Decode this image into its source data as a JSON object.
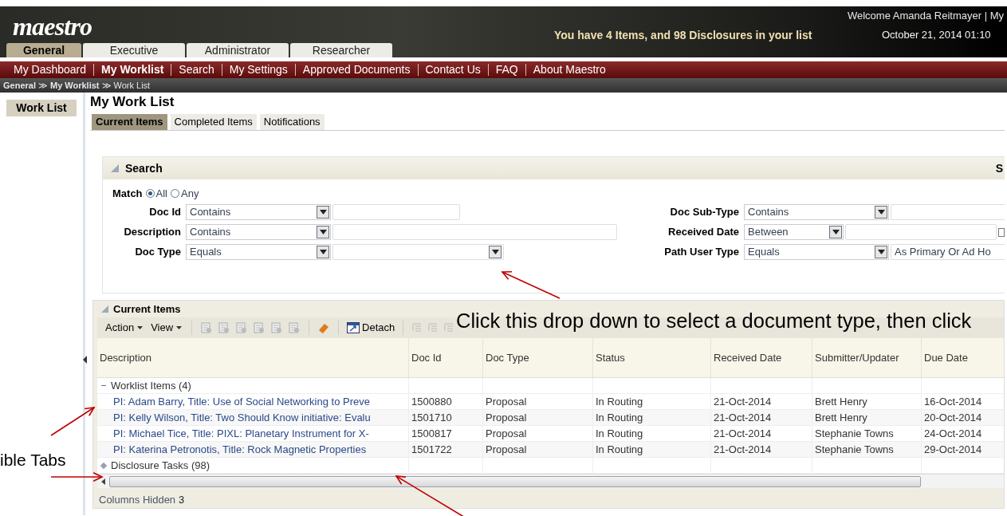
{
  "header": {
    "logo": "maestro",
    "welcome": "Welcome Amanda Reitmayer | My",
    "message": "You have 4 Items, and 98 Disclosures in your list",
    "datetime": "October 21, 2014 01:10"
  },
  "role_tabs": [
    {
      "label": "General",
      "selected": true
    },
    {
      "label": "Executive",
      "selected": false
    },
    {
      "label": "Administrator",
      "selected": false
    },
    {
      "label": "Researcher",
      "selected": false
    }
  ],
  "nav": [
    {
      "label": "My Dashboard",
      "selected": false
    },
    {
      "label": "My Worklist",
      "selected": true
    },
    {
      "label": "Search",
      "selected": false
    },
    {
      "label": "My Settings",
      "selected": false
    },
    {
      "label": "Approved Documents",
      "selected": false
    },
    {
      "label": "Contact Us",
      "selected": false
    },
    {
      "label": "FAQ",
      "selected": false
    },
    {
      "label": "About Maestro",
      "selected": false
    }
  ],
  "breadcrumb": [
    "General",
    "My Worklist",
    "Work List"
  ],
  "breadcrumb_separator": "≫",
  "sidebar": {
    "items": [
      {
        "label": "Work List",
        "selected": true
      }
    ]
  },
  "page_title": "My Work List",
  "content_tabs": [
    {
      "label": "Current Items",
      "selected": true
    },
    {
      "label": "Completed Items",
      "selected": false
    },
    {
      "label": "Notifications",
      "selected": false
    }
  ],
  "search": {
    "title": "Search",
    "corner_text": "S",
    "match": {
      "label": "Match",
      "options": [
        {
          "label": "All",
          "selected": true
        },
        {
          "label": "Any",
          "selected": false
        }
      ]
    },
    "left_fields": [
      {
        "label": "Doc Id",
        "operator": "Contains",
        "kind": "text"
      },
      {
        "label": "Description",
        "operator": "Contains",
        "kind": "wide"
      },
      {
        "label": "Doc Type",
        "operator": "Equals",
        "kind": "dropdown"
      }
    ],
    "right_fields": [
      {
        "label": "Doc Sub-Type",
        "operator": "Contains",
        "kind": "text"
      },
      {
        "label": "Received Date",
        "operator": "Between",
        "kind": "date"
      },
      {
        "label": "Path User Type",
        "operator": "Equals",
        "kind": "dropdown",
        "value": "As Primary Or Ad Ho"
      }
    ]
  },
  "current_items": {
    "title": "Current Items",
    "toolbar": {
      "action": "Action",
      "view": "View",
      "detach": "Detach"
    },
    "columns": [
      "Description",
      "Doc Id",
      "Doc Type",
      "Status",
      "Received Date",
      "Submitter/Updater",
      "Due Date"
    ],
    "groups": [
      {
        "label": "Worklist Items (4)",
        "expanded": true,
        "rows": [
          [
            "PI: Adam Barry, Title: Use of Social Networking to Preve",
            "1500880",
            "Proposal",
            "In Routing",
            "21-Oct-2014",
            "Brett Henry",
            "16-Oct-2014"
          ],
          [
            "PI: Kelly Wilson, Title: Two Should Know initiative: Evalu",
            "1501710",
            "Proposal",
            "In Routing",
            "21-Oct-2014",
            "Brett Henry",
            "20-Oct-2014"
          ],
          [
            "PI: Michael Tice, Title: PIXL: Planetary Instrument for X-",
            "1500817",
            "Proposal",
            "In Routing",
            "21-Oct-2014",
            "Stephanie Towns",
            "24-Oct-2014"
          ],
          [
            "PI: Katerina Petronotis, Title: Rock Magnetic Properties",
            "1501722",
            "Proposal",
            "In Routing",
            "21-Oct-2014",
            "Stephanie Towns",
            "29-Oct-2014"
          ]
        ]
      },
      {
        "label": "Disclosure Tasks (98)",
        "expanded": false
      }
    ],
    "columns_hidden": {
      "label": "Columns Hidden",
      "value": "3"
    }
  },
  "annotations": [
    {
      "text": "Click this drop down to select a document type, then click"
    },
    {
      "text": "ible Tabs"
    }
  ]
}
